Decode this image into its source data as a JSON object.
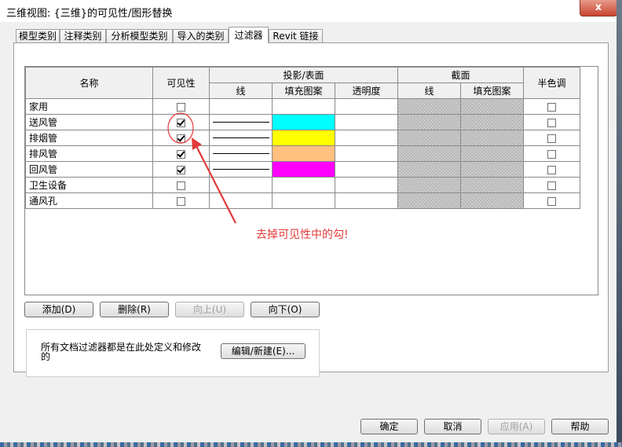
{
  "window": {
    "title": "三维视图: {三维}的可见性/图形替换",
    "close_label": "x"
  },
  "tabs": [
    {
      "label": "模型类别"
    },
    {
      "label": "注释类别"
    },
    {
      "label": "分析模型类别"
    },
    {
      "label": "导入的类别"
    },
    {
      "label": "过滤器",
      "active": true
    },
    {
      "label": "Revit 链接"
    }
  ],
  "grid": {
    "headers": {
      "name": "名称",
      "visibility": "可见性",
      "projection_surface": "投影/表面",
      "cut": "截面",
      "halftone": "半色调",
      "proj_line": "线",
      "proj_fill": "填充图案",
      "proj_transparency": "透明度",
      "cut_line": "线",
      "cut_fill": "填充图案"
    },
    "rows": [
      {
        "name": "家用",
        "visible": false,
        "has_line": false,
        "fill_color": "",
        "halftone": false
      },
      {
        "name": "送风管",
        "visible": true,
        "has_line": true,
        "fill_color": "#00ffff",
        "halftone": false
      },
      {
        "name": "排烟管",
        "visible": true,
        "has_line": true,
        "fill_color": "#ffff00",
        "halftone": false
      },
      {
        "name": "排风管",
        "visible": true,
        "has_line": true,
        "fill_color": "#ffc080",
        "halftone": false
      },
      {
        "name": "回风管",
        "visible": true,
        "has_line": true,
        "fill_color": "#ff00ff",
        "halftone": false
      },
      {
        "name": "卫生设备",
        "visible": false,
        "has_line": false,
        "fill_color": "",
        "halftone": false
      },
      {
        "name": "通风孔",
        "visible": false,
        "has_line": false,
        "fill_color": "",
        "halftone": false
      }
    ]
  },
  "filter_buttons": {
    "add": "添加(D)",
    "delete": "删除(R)",
    "up": "向上(U)",
    "down": "向下(O)"
  },
  "info": {
    "text": "所有文档过滤器都是在此处定义和修改的",
    "edit_button": "编辑/新建(E)..."
  },
  "annotation": {
    "text": "去掉可见性中的勾!",
    "color": "#e23a3a"
  },
  "footer": {
    "ok": "确定",
    "cancel": "取消",
    "apply": "应用(A)",
    "help": "帮助"
  }
}
